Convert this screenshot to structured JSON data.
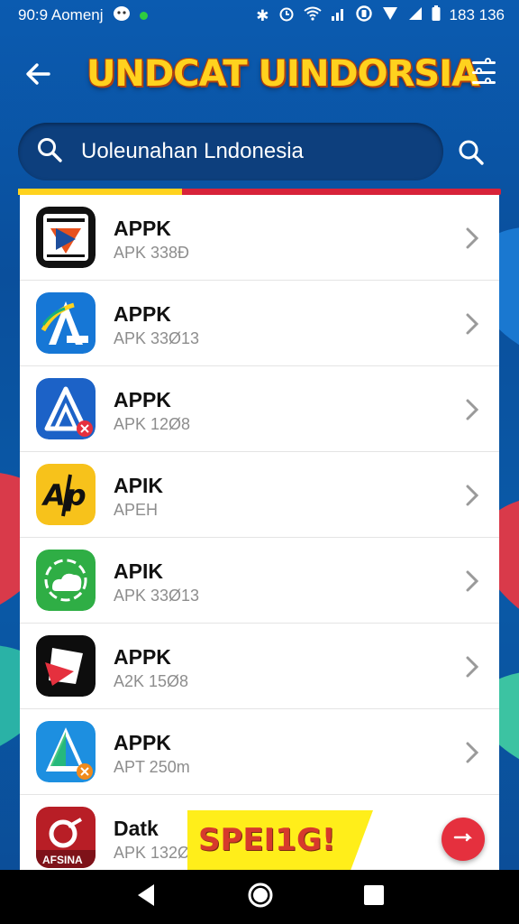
{
  "status_bar": {
    "time": "90:9 Aomenj",
    "right_text": "183 136",
    "icons": [
      "gamepad-icon",
      "notification-dot-icon",
      "bluetooth-icon",
      "alarm-icon",
      "wifi-icon",
      "signal-icon",
      "data-icon",
      "signal-triangle-icon",
      "battery-icon"
    ]
  },
  "header": {
    "title": "UNDCAT UINDORSIA",
    "back_icon": "back-arrow-icon",
    "menu_icon": "sliders-icon"
  },
  "search": {
    "value": "Uoleunahan Lndonesia",
    "placeholder": "Uoleunahan Lndonesia",
    "icon": "search-icon"
  },
  "progress": {
    "fraction": 0.34,
    "colors": {
      "track": "#d7233a",
      "fill": "#ffd21e"
    }
  },
  "apps": [
    {
      "name": "APPK",
      "meta": "APK 338Ð",
      "icon": "video-app-icon"
    },
    {
      "name": "APPK",
      "meta": "APK 33Ø13",
      "icon": "letter-a-blue-icon"
    },
    {
      "name": "APPK",
      "meta": "APK 12Ø8",
      "icon": "letter-a-outline-icon"
    },
    {
      "name": "APIK",
      "meta": "APEH",
      "icon": "ap-yellow-icon"
    },
    {
      "name": "APIK",
      "meta": "APK 33Ø13",
      "icon": "cloud-green-icon"
    },
    {
      "name": "APPK",
      "meta": "A2K 15Ø8",
      "icon": "play-black-icon"
    },
    {
      "name": "APPK",
      "meta": "APT 250m",
      "icon": "letter-a-triangle-icon"
    },
    {
      "name": "Datk",
      "meta": "APK 132Ø",
      "icon": "red-app-icon",
      "icon_label": "AFSINA"
    }
  ],
  "promo": {
    "label": "SPEI1G!"
  },
  "nav": {
    "back": "nav-back-icon",
    "home": "nav-home-icon",
    "recents": "nav-recents-icon"
  },
  "colors": {
    "accent_yellow": "#ffd21e",
    "accent_red": "#d7233a",
    "background_blue": "#0a4f9c"
  }
}
